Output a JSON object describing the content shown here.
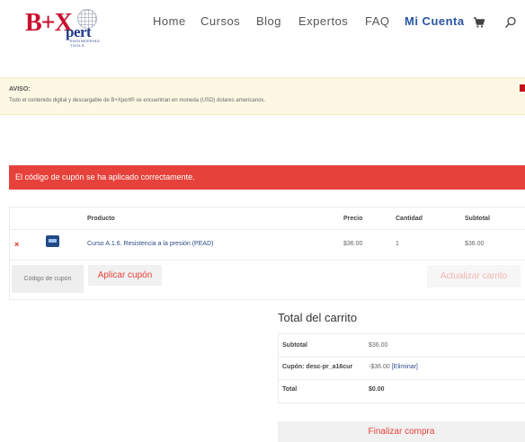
{
  "header": {
    "logo": {
      "mark": "B+X",
      "suffix": "pert",
      "tagline": "ENGINEERING TOOLS"
    },
    "nav": [
      {
        "label": "Home"
      },
      {
        "label": "Cursos"
      },
      {
        "label": "Blog"
      },
      {
        "label": "Expertos"
      },
      {
        "label": "FAQ"
      },
      {
        "label": "Mi Cuenta",
        "active": true
      }
    ],
    "icons": {
      "cart": "shopping-cart-icon",
      "search": "search-icon"
    }
  },
  "notice": {
    "title": "AVISO:",
    "text": "Todo el contenido digital y descargable de B+Xpert® se encuentran en moneda (USD) dolares americanos."
  },
  "alert": {
    "message": "El código de cupón se ha aplicado correctamente.",
    "color": "#e6423b"
  },
  "cart": {
    "columns": [
      "Producto",
      "Precio",
      "Cantidad",
      "Subtotal"
    ],
    "items": [
      {
        "product": "Curso A.1.6. Resistencia a la presión (PEAD)",
        "price": "$36.00",
        "quantity": "1",
        "subtotal": "$36.00"
      }
    ],
    "coupon_placeholder": "Código de cupón",
    "apply_label": "Aplicar cupón",
    "update_label": "Actualizar carrito"
  },
  "totals": {
    "title": "Total del carrito",
    "subtotal_label": "Subtotal",
    "subtotal_value": "$36.00",
    "coupon_label": "Cupón: desc-pr_a16cur",
    "coupon_value": "-$36.00",
    "coupon_remove": "[Eliminar]",
    "total_label": "Total",
    "total_value": "$0.00",
    "checkout_label": "Finalizar compra"
  },
  "colors": {
    "brand_red": "#c8102e",
    "brand_blue": "#1f3a8a",
    "accent": "#e6423b",
    "link": "#2b55a3"
  }
}
